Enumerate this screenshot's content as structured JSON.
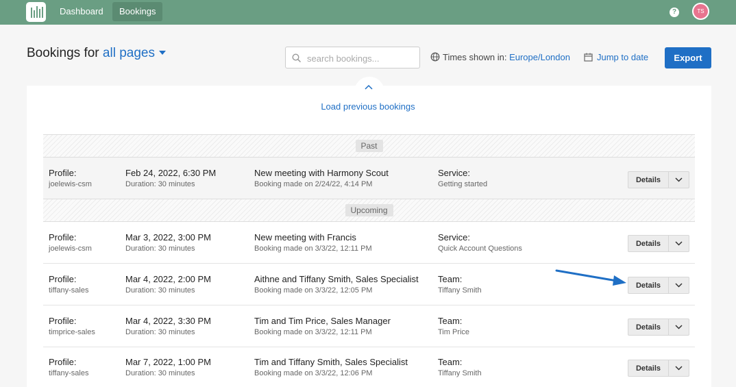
{
  "nav": {
    "dashboard": "Dashboard",
    "bookings": "Bookings",
    "help_icon": "?",
    "avatar_initials": "TS"
  },
  "header": {
    "title_prefix": "Bookings for",
    "scope": "all pages",
    "search_placeholder": "search bookings...",
    "timezone_label": "Times shown in:",
    "timezone_value": "Europe/London",
    "jump_to_date": "Jump to date",
    "export": "Export"
  },
  "load_previous": "Load previous bookings",
  "sections": {
    "past": "Past",
    "upcoming": "Upcoming"
  },
  "bookings": [
    {
      "profile_label": "Profile:",
      "profile": "joelewis-csm",
      "datetime": "Feb 24, 2022, 6:30 PM",
      "duration": "Duration: 30 minutes",
      "title": "New meeting with Harmony Scout",
      "made": "Booking made on 2/24/22, 4:14 PM",
      "kind_label": "Service:",
      "kind_value": "Getting started",
      "details": "Details"
    },
    {
      "profile_label": "Profile:",
      "profile": "joelewis-csm",
      "datetime": "Mar 3, 2022, 3:00 PM",
      "duration": "Duration: 30 minutes",
      "title": "New meeting with Francis",
      "made": "Booking made on 3/3/22, 12:11 PM",
      "kind_label": "Service:",
      "kind_value": "Quick Account Questions",
      "details": "Details"
    },
    {
      "profile_label": "Profile:",
      "profile": "tiffany-sales",
      "datetime": "Mar 4, 2022, 2:00 PM",
      "duration": "Duration: 30 minutes",
      "title": "Aithne and Tiffany Smith, Sales Specialist",
      "made": "Booking made on 3/3/22, 12:05 PM",
      "kind_label": "Team:",
      "kind_value": "Tiffany Smith",
      "details": "Details"
    },
    {
      "profile_label": "Profile:",
      "profile": "timprice-sales",
      "datetime": "Mar 4, 2022, 3:30 PM",
      "duration": "Duration: 30 minutes",
      "title": "Tim and Tim Price, Sales Manager",
      "made": "Booking made on 3/3/22, 12:11 PM",
      "kind_label": "Team:",
      "kind_value": "Tim Price",
      "details": "Details"
    },
    {
      "profile_label": "Profile:",
      "profile": "tiffany-sales",
      "datetime": "Mar 7, 2022, 1:00 PM",
      "duration": "Duration: 30 minutes",
      "title": "Tim and Tiffany Smith, Sales Specialist",
      "made": "Booking made on 3/3/22, 12:06 PM",
      "kind_label": "Team:",
      "kind_value": "Tiffany Smith",
      "details": "Details"
    }
  ],
  "colors": {
    "topbar": "#6a9e83",
    "accent": "#1f6fc5",
    "avatar": "#e8748f",
    "annotation_arrow": "#1f6fc5"
  }
}
